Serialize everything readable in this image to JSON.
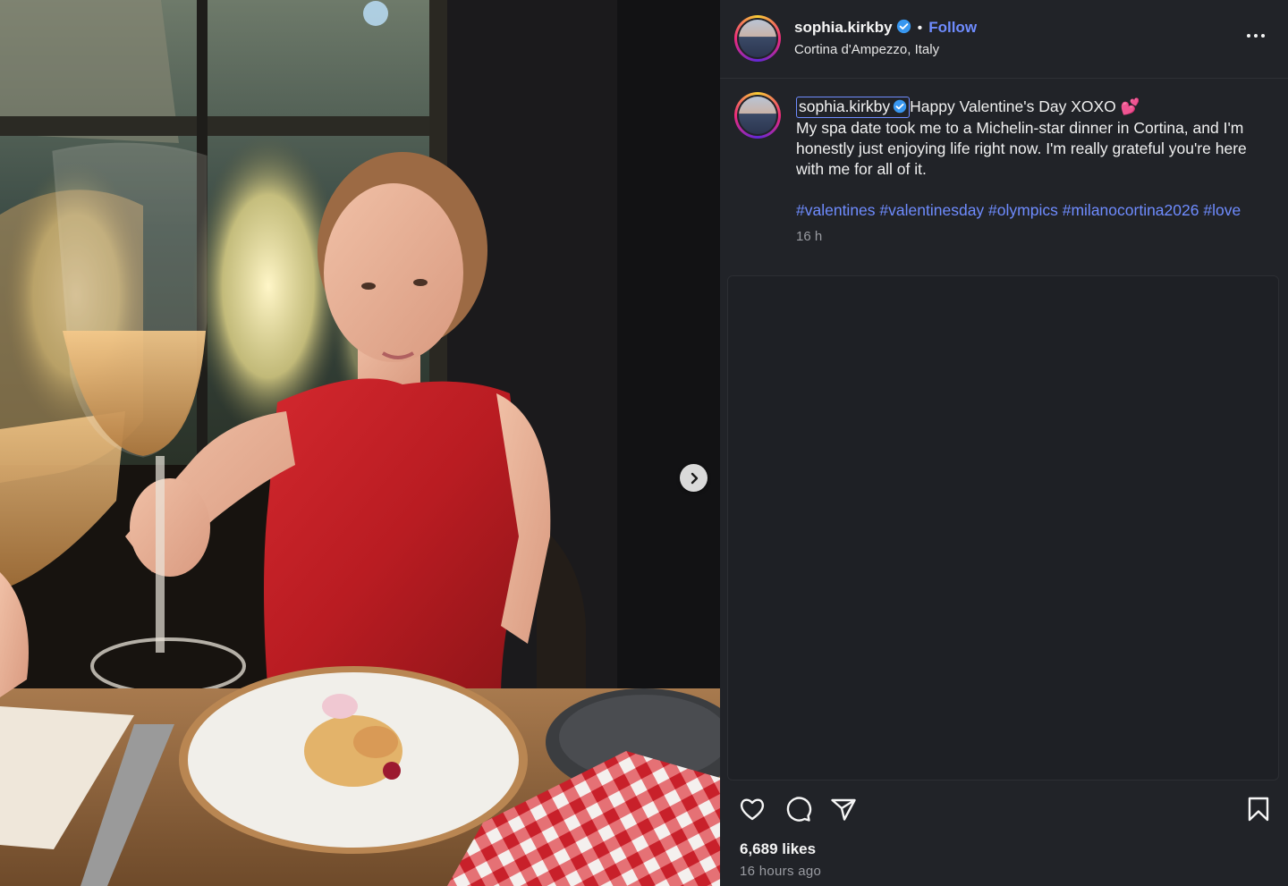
{
  "post": {
    "username": "sophia.kirkby",
    "verified": true,
    "follow_label": "Follow",
    "separator": "•",
    "location": "Cortina d'Ampezzo, Italy"
  },
  "caption": {
    "username": "sophia.kirkby",
    "text_line1": "Happy Valentine's Day XOXO 💕",
    "text_body": "My spa date took me to a Michelin-star dinner in Cortina, and I'm honestly just enjoying life right now. I'm really grateful you're here with me for all of it.",
    "hashtags": [
      "#valentines",
      "#valentinesday",
      "#olympics",
      "#milanocortina2026",
      "#love"
    ],
    "time": "16 h"
  },
  "stats": {
    "likes": "6,689 likes",
    "posted": "16 hours ago"
  },
  "icons": {
    "more": "more-options-icon",
    "like": "heart-icon",
    "comment": "comment-icon",
    "share": "share-icon",
    "save": "bookmark-icon",
    "next": "chevron-right-icon",
    "verified": "verified-badge-icon"
  },
  "colors": {
    "link": "#6f8cff",
    "panel_bg": "#212328",
    "verified": "#3897f0"
  }
}
